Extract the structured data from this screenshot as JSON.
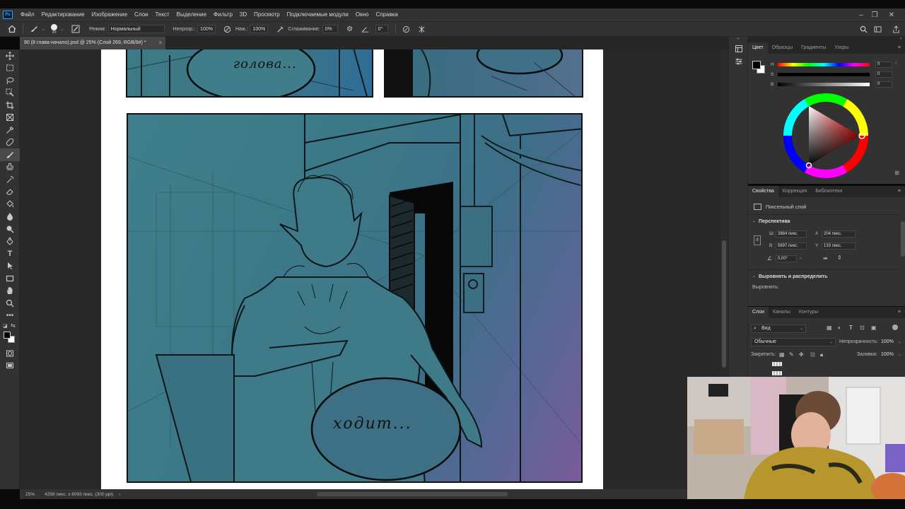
{
  "menubar": {
    "items": [
      "Файл",
      "Редактирование",
      "Изображение",
      "Слои",
      "Текст",
      "Выделение",
      "Фильтр",
      "3D",
      "Просмотр",
      "Подключаемые модули",
      "Окно",
      "Справка"
    ],
    "logo": "Ps"
  },
  "options": {
    "brush_size": "20",
    "mode_label": "Режим:",
    "mode_value": "Нормальный",
    "opacity_label": "Непрозр.:",
    "opacity_value": "100%",
    "pressure_label": "Наж.:",
    "pressure_value": "100%",
    "smoothing_label": "Сглаживание:",
    "smoothing_value": "0%",
    "angle_value": "0°"
  },
  "document": {
    "tab_title": "90 (8 глава-начало).psd @ 25% (Слой 269, RGB/8#) *",
    "close": "×"
  },
  "artwork": {
    "bubble_top": "голова...",
    "bubble_main": "ходит..."
  },
  "status": {
    "zoom": "25%",
    "dimensions": "4256 пикс. x 6093 пикс. (300 ppi)",
    "arrow": "›"
  },
  "color_panel": {
    "tabs": [
      "Цвет",
      "Образцы",
      "Градиенты",
      "Узоры"
    ],
    "h_label": "H",
    "s_label": "S",
    "b_label": "B",
    "h_value": "0",
    "s_value": "0",
    "b_value": "0",
    "unit": "°"
  },
  "properties_panel": {
    "tabs": [
      "Свойства",
      "Коррекция",
      "Библиотеки"
    ],
    "layer_type": "Пиксельный слой",
    "transform_section": "Перспектива",
    "w_label": "Ш",
    "w_value": "3884 пикс.",
    "h_label": "В",
    "h_value": "5697 пикс.",
    "x_label": "X",
    "x_value": "204 пикс.",
    "y_label": "Y",
    "y_value": "133 пикс.",
    "angle_value": "0,00°",
    "align_section": "Выровнять и распределить",
    "align_label": "Выровнять:"
  },
  "layers_panel": {
    "tabs": [
      "Слои",
      "Каналы",
      "Контуры"
    ],
    "filter_label": "Вид",
    "blend_mode": "Обычные",
    "opacity_label": "Непрозрачность:",
    "opacity_value": "100%",
    "lock_label": "Закрепить:",
    "fill_label": "Заливка:",
    "fill_value": "100%"
  },
  "colors": {
    "ui_bg": "#323232",
    "panel_dark": "#262626",
    "canvas_bg": "#282828",
    "art_teal": "#3f7f8c",
    "art_purple": "#7a5a9a",
    "accent_blue": "#31a8ff"
  }
}
